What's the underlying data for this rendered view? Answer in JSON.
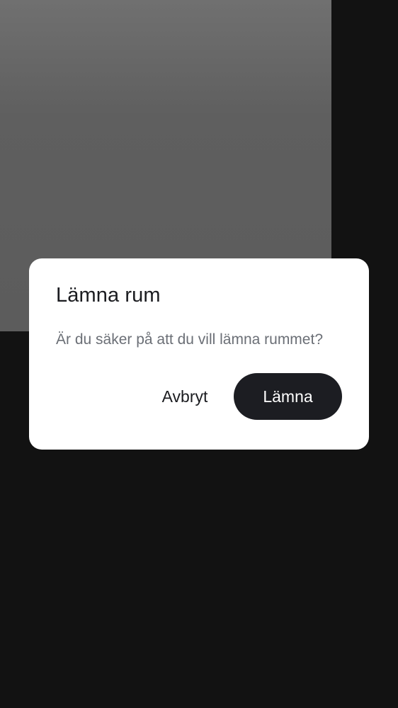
{
  "dialog": {
    "title": "Lämna rum",
    "message": "Är du säker på att du vill lämna rummet?",
    "cancel_label": "Avbryt",
    "confirm_label": "Lämna"
  },
  "colors": {
    "background": "#121212",
    "video_tile": "#5f5f5f",
    "dialog_surface": "#ffffff",
    "primary_button": "#1c1d22",
    "message_text": "#6b6f76"
  }
}
